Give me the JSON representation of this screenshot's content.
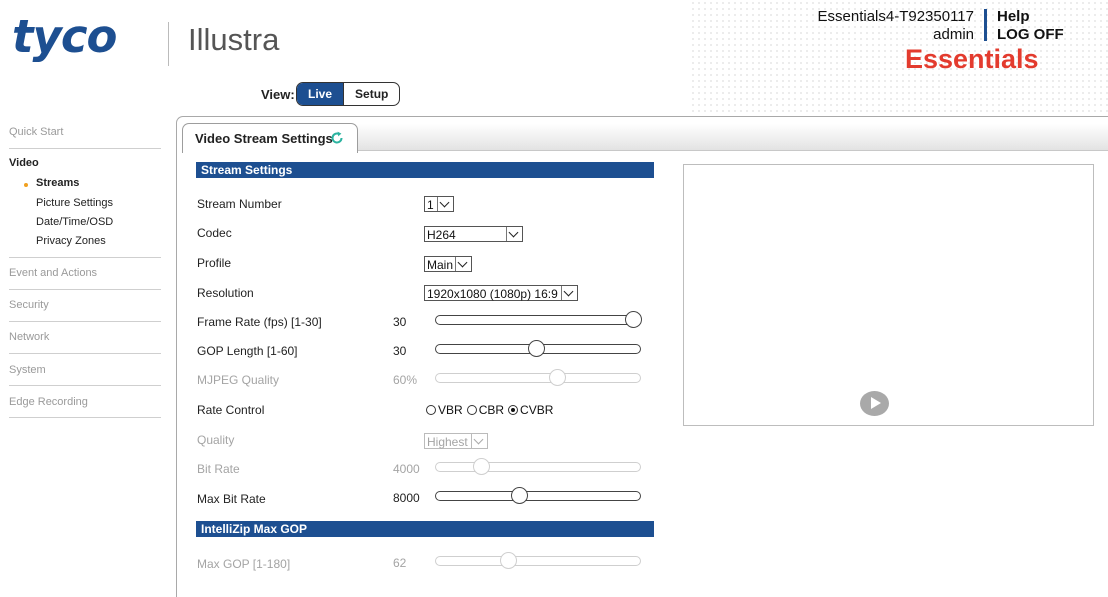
{
  "header": {
    "brand": "tyco",
    "product": "Illustra",
    "device_name": "Essentials4-T92350117",
    "user": "admin",
    "help": "Help",
    "logoff": "LOG OFF",
    "edition": "Essentials",
    "accent_color": "#1d4f91",
    "edition_color": "#e33b2e"
  },
  "view": {
    "label": "View:",
    "options": [
      "Live",
      "Setup"
    ],
    "selected": "Live"
  },
  "sidebar": {
    "quick_start": "Quick Start",
    "video": "Video",
    "video_items": [
      "Streams",
      "Picture Settings",
      "Date/Time/OSD",
      "Privacy Zones"
    ],
    "active_item": "Streams",
    "event_actions": "Event and Actions",
    "security": "Security",
    "network": "Network",
    "system": "System",
    "edge_recording": "Edge Recording"
  },
  "tab": {
    "label": "Video Stream Settings",
    "icon": "refresh-icon"
  },
  "stream_settings": {
    "title": "Stream Settings",
    "stream_number": {
      "label": "Stream Number",
      "value": "1"
    },
    "codec": {
      "label": "Codec",
      "value": "H264"
    },
    "profile": {
      "label": "Profile",
      "value": "Main"
    },
    "resolution": {
      "label": "Resolution",
      "value": "1920x1080 (1080p) 16:9"
    },
    "frame_rate": {
      "label": "Frame Rate (fps) [1-30]",
      "value": "30",
      "min": 1,
      "max": 30
    },
    "gop_length": {
      "label": "GOP Length [1-60]",
      "value": "30",
      "min": 1,
      "max": 60
    },
    "mjpeg_quality": {
      "label": "MJPEG Quality",
      "value": "60%",
      "level": 0.6,
      "disabled": true
    },
    "rate_control": {
      "label": "Rate Control",
      "options": [
        "VBR",
        "CBR",
        "CVBR"
      ],
      "selected": "CVBR"
    },
    "quality": {
      "label": "Quality",
      "value": "Highest",
      "disabled": true
    },
    "bit_rate": {
      "label": "Bit Rate",
      "value": "4000",
      "level": 0.2,
      "disabled": true
    },
    "max_bit_rate": {
      "label": "Max Bit Rate",
      "value": "8000",
      "level": 0.4
    }
  },
  "intellizip": {
    "title": "IntelliZip Max GOP",
    "max_gop": {
      "label": "Max GOP [1-180]",
      "value": "62",
      "min": 1,
      "max": 180,
      "disabled": true
    }
  },
  "preview": {
    "play_icon": "play-icon"
  }
}
